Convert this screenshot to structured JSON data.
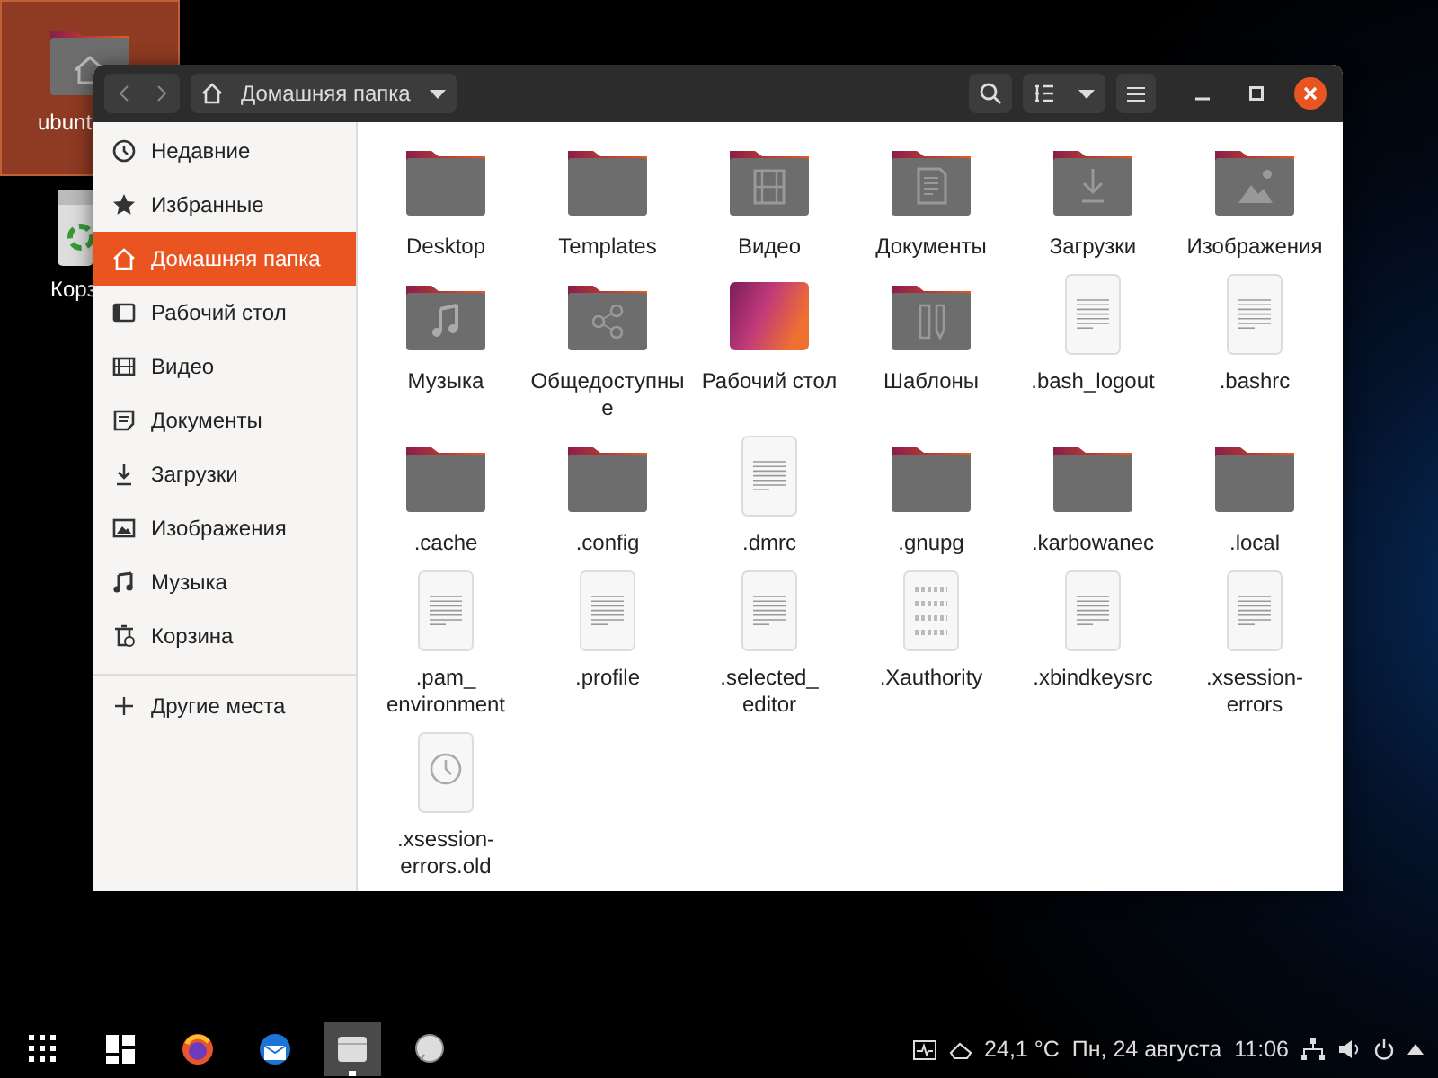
{
  "desktop_icons": [
    {
      "label": "ubunt",
      "kind": "home",
      "selected": true
    },
    {
      "label": "Корз",
      "kind": "trash",
      "selected": false
    }
  ],
  "window": {
    "back_disabled": true,
    "forward_disabled": true,
    "path": "Домашняя папка"
  },
  "sidebar": {
    "items": [
      {
        "label": "Недавние",
        "kind": "recent",
        "selected": false
      },
      {
        "label": "Избранные",
        "kind": "starred",
        "selected": false
      },
      {
        "label": "Домашняя папка",
        "kind": "home",
        "selected": true
      },
      {
        "label": "Рабочий стол",
        "kind": "desktop",
        "selected": false
      },
      {
        "label": "Видео",
        "kind": "video",
        "selected": false
      },
      {
        "label": "Документы",
        "kind": "documents",
        "selected": false
      },
      {
        "label": "Загрузки",
        "kind": "downloads",
        "selected": false
      },
      {
        "label": "Изображения",
        "kind": "pictures",
        "selected": false
      },
      {
        "label": "Музыка",
        "kind": "music",
        "selected": false
      },
      {
        "label": "Корзина",
        "kind": "trash",
        "selected": false
      }
    ],
    "other": {
      "label": "Другие места"
    }
  },
  "files": [
    {
      "name": "Desktop",
      "kind": "folder"
    },
    {
      "name": "Templates",
      "kind": "folder"
    },
    {
      "name": "Видео",
      "kind": "videofolder"
    },
    {
      "name": "Документы",
      "kind": "docfolder"
    },
    {
      "name": "Загрузки",
      "kind": "downloadfolder"
    },
    {
      "name": "Изображения",
      "kind": "picturefolder"
    },
    {
      "name": "Музыка",
      "kind": "musicfolder"
    },
    {
      "name": "Общедоступные",
      "kind": "sharefolder"
    },
    {
      "name": "Рабочий стол",
      "kind": "desktopfolder"
    },
    {
      "name": "Шаблоны",
      "kind": "templatefolder"
    },
    {
      "name": ".bash_logout",
      "kind": "text"
    },
    {
      "name": ".bashrc",
      "kind": "text"
    },
    {
      "name": ".cache",
      "kind": "folder"
    },
    {
      "name": ".config",
      "kind": "folder"
    },
    {
      "name": ".dmrc",
      "kind": "text"
    },
    {
      "name": ".gnupg",
      "kind": "folder"
    },
    {
      "name": ".karbowanec",
      "kind": "folder"
    },
    {
      "name": ".local",
      "kind": "folder"
    },
    {
      "name": ".pam_ environment",
      "kind": "text"
    },
    {
      "name": ".profile",
      "kind": "text"
    },
    {
      "name": ".selected_ editor",
      "kind": "text"
    },
    {
      "name": ".Xauthority",
      "kind": "binary"
    },
    {
      "name": ".xbindkeysrc",
      "kind": "text"
    },
    {
      "name": ".xsession- errors",
      "kind": "text"
    },
    {
      "name": ".xsession- errors.old",
      "kind": "backup"
    }
  ],
  "taskbar": {
    "apps": [
      {
        "kind": "appgrid",
        "active": false
      },
      {
        "kind": "tiles",
        "active": false
      },
      {
        "kind": "firefox",
        "active": false
      },
      {
        "kind": "mail",
        "active": false
      },
      {
        "kind": "files",
        "active": true
      },
      {
        "kind": "chat",
        "active": false
      }
    ],
    "weather": "24,1 °C",
    "date": "Пн, 24 августа",
    "time": "11:06"
  }
}
